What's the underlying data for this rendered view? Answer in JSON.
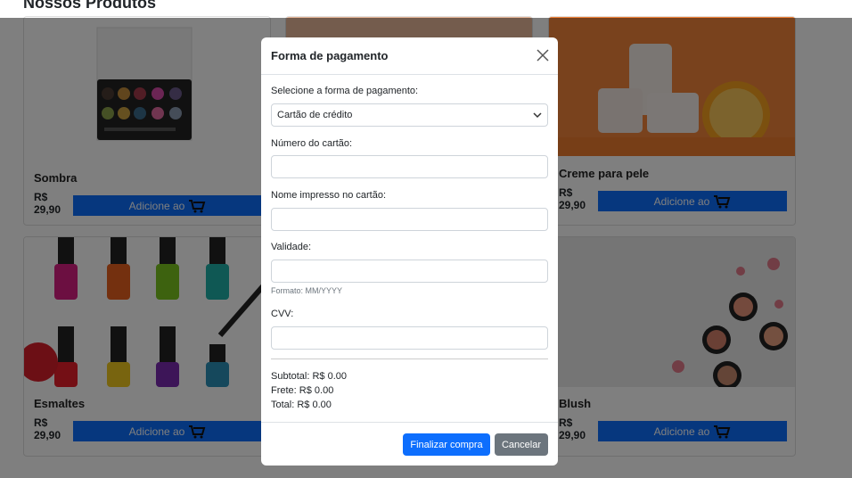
{
  "page": {
    "title": "Nossos Produtos"
  },
  "products": [
    {
      "name": "Sombra",
      "price": "R$ 29,90",
      "button": "Adicione ao"
    },
    {
      "name": "",
      "price": "",
      "button": ""
    },
    {
      "name": "Creme para pele",
      "price": "R$ 29,90",
      "button": "Adicione ao"
    },
    {
      "name": "Esmaltes",
      "price": "R$ 29,90",
      "button": "Adicione ao"
    },
    {
      "name": "",
      "price": "",
      "button": ""
    },
    {
      "name": "Blush",
      "price": "R$ 29,90",
      "button": "Adicione ao"
    }
  ],
  "modal": {
    "title": "Forma de pagamento",
    "payment_label": "Selecione a forma de pagamento:",
    "payment_selected": "Cartão de crédito",
    "card_number_label": "Número do cartão:",
    "card_name_label": "Nome impresso no cartão:",
    "validity_label": "Validade:",
    "validity_help": "Formato: MM/YYYY",
    "cvv_label": "CVV:",
    "subtotal": "Subtotal: R$ 0.00",
    "shipping": "Frete: R$ 0.00",
    "total": "Total: R$ 0.00",
    "confirm_button": "Finalizar compra",
    "cancel_button": "Cancelar"
  },
  "colors": {
    "primary": "#0d6efd",
    "secondary": "#6c757d",
    "backdrop": "rgba(0,0,0,0.5)"
  }
}
